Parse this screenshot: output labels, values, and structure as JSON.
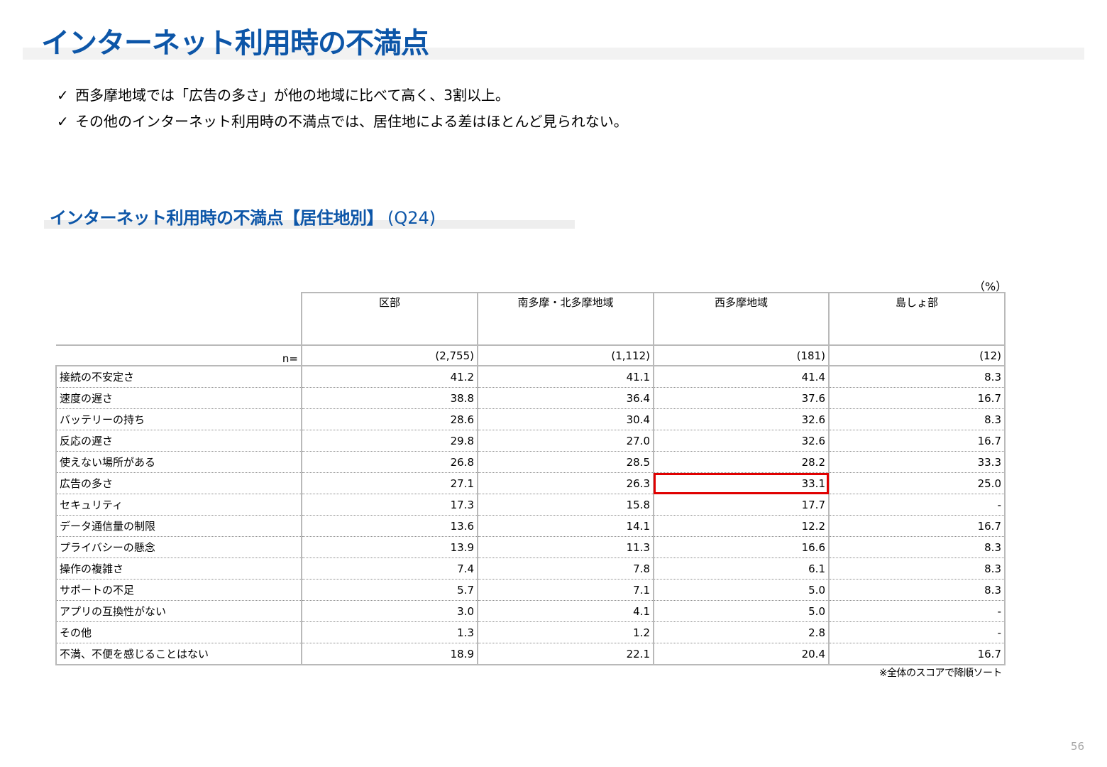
{
  "title": "インターネット利用時の不満点",
  "bullets": [
    {
      "icon": "check-icon",
      "mark": "✓",
      "text": "西多摩地域では「広告の多さ」が他の地域に比べて高く、3割以上。"
    },
    {
      "icon": "check-icon",
      "mark": "✓",
      "text": "その他のインターネット利用時の不満点では、居住地による差はほとんど見られない。"
    }
  ],
  "subtitle": {
    "main": "インターネット利用時の不満点【居住地別】",
    "question": "(Q24)"
  },
  "table": {
    "unit": "（%）",
    "n_label": "n=",
    "columns": [
      {
        "name": "区部",
        "n": "(2,755)"
      },
      {
        "name": "南多摩・北多摩地域",
        "n": "(1,112)"
      },
      {
        "name": "西多摩地域",
        "n": "(181)"
      },
      {
        "name": "島しょ部",
        "n": "(12)"
      }
    ],
    "rows": [
      {
        "label": "接続の不安定さ",
        "values": [
          "41.2",
          "41.1",
          "41.4",
          "8.3"
        ]
      },
      {
        "label": "速度の遅さ",
        "values": [
          "38.8",
          "36.4",
          "37.6",
          "16.7"
        ]
      },
      {
        "label": "バッテリーの持ち",
        "values": [
          "28.6",
          "30.4",
          "32.6",
          "8.3"
        ]
      },
      {
        "label": "反応の遅さ",
        "values": [
          "29.8",
          "27.0",
          "32.6",
          "16.7"
        ]
      },
      {
        "label": "使えない場所がある",
        "values": [
          "26.8",
          "28.5",
          "28.2",
          "33.3"
        ]
      },
      {
        "label": "広告の多さ",
        "values": [
          "27.1",
          "26.3",
          "33.1",
          "25.0"
        ]
      },
      {
        "label": "セキュリティ",
        "values": [
          "17.3",
          "15.8",
          "17.7",
          "-"
        ]
      },
      {
        "label": "データ通信量の制限",
        "values": [
          "13.6",
          "14.1",
          "12.2",
          "16.7"
        ]
      },
      {
        "label": "プライバシーの懸念",
        "values": [
          "13.9",
          "11.3",
          "16.6",
          "8.3"
        ]
      },
      {
        "label": "操作の複雑さ",
        "values": [
          "7.4",
          "7.8",
          "6.1",
          "8.3"
        ]
      },
      {
        "label": "サポートの不足",
        "values": [
          "5.7",
          "7.1",
          "5.0",
          "8.3"
        ]
      },
      {
        "label": "アプリの互換性がない",
        "values": [
          "3.0",
          "4.1",
          "5.0",
          "-"
        ]
      },
      {
        "label": "その他",
        "values": [
          "1.3",
          "1.2",
          "2.8",
          "-"
        ]
      },
      {
        "label": "不満、不便を感じることはない",
        "values": [
          "18.9",
          "22.1",
          "20.4",
          "16.7"
        ]
      }
    ],
    "highlight_cell": {
      "row": "広告の多さ",
      "column": "西多摩地域",
      "color": "#e00000"
    },
    "footnote": "※全体のスコアで降順ソート"
  },
  "page_number": "56",
  "colors": {
    "title": "#0d56a8",
    "highlight": "#e00000",
    "border": "#b9b9b9"
  }
}
